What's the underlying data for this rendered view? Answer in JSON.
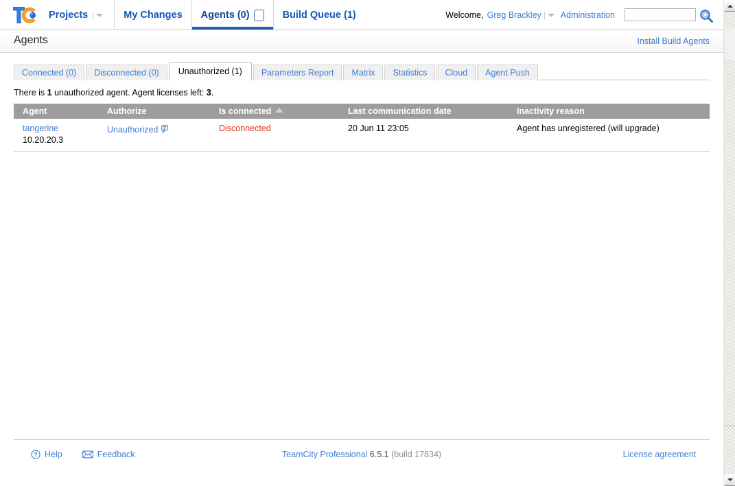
{
  "topbar": {
    "logo_alt": "TeamCity",
    "nav": [
      {
        "label": "Projects",
        "has_caret": true,
        "active": false
      },
      {
        "label": "My Changes",
        "has_caret": false,
        "active": false
      },
      {
        "label": "Agents (0)",
        "has_caret": false,
        "active": true,
        "badge": true
      },
      {
        "label": "Build Queue (1)",
        "has_caret": false,
        "active": false
      }
    ],
    "welcome_label": "Welcome,",
    "user_name": "Greg Brackley",
    "administration_label": "Administration",
    "search_value": "",
    "search_placeholder": ""
  },
  "heading": {
    "title": "Agents",
    "install_link": "Install Build Agents"
  },
  "tabs": [
    {
      "label": "Connected (0)",
      "selected": false
    },
    {
      "label": "Disconnected (0)",
      "selected": false
    },
    {
      "label": "Unauthorized (1)",
      "selected": true
    },
    {
      "label": "Parameters Report",
      "selected": false
    },
    {
      "label": "Matrix",
      "selected": false
    },
    {
      "label": "Statistics",
      "selected": false
    },
    {
      "label": "Cloud",
      "selected": false
    },
    {
      "label": "Agent Push",
      "selected": false
    }
  ],
  "summary": {
    "prefix": "There is ",
    "count": "1",
    "middle": " unauthorized agent. Agent licenses left: ",
    "licenses": "3",
    "suffix": "."
  },
  "table": {
    "columns": [
      {
        "key": "agent",
        "label": "Agent",
        "sorted": false
      },
      {
        "key": "authorize",
        "label": "Authorize",
        "sorted": false
      },
      {
        "key": "connected",
        "label": "Is connected",
        "sorted": true,
        "sort_direction": "asc"
      },
      {
        "key": "lastcomm",
        "label": "Last communication date",
        "sorted": false
      },
      {
        "key": "reason",
        "label": "Inactivity reason",
        "sorted": false
      }
    ],
    "rows": [
      {
        "agent_name": "tangerine",
        "agent_ip": "10.20.20.3",
        "authorize": "Unauthorized",
        "has_comment_icon": true,
        "is_connected": "Disconnected",
        "last_communication": "20 Jun 11 23:05",
        "inactivity_reason": "Agent has unregistered (will upgrade)"
      }
    ]
  },
  "footer": {
    "help_label": "Help",
    "feedback_label": "Feedback",
    "product_name": "TeamCity Professional",
    "version": "6.5.1",
    "build": "(build 17834)",
    "license_label": "License agreement"
  },
  "colors": {
    "link": "#3f7ed0",
    "nav_link": "#1459b4",
    "accent": "#1f5fae",
    "table_header_bg": "#9d9d9d",
    "error": "#e0331f",
    "logo_blue": "#2a6fd6",
    "logo_orange": "#f08a1a"
  }
}
